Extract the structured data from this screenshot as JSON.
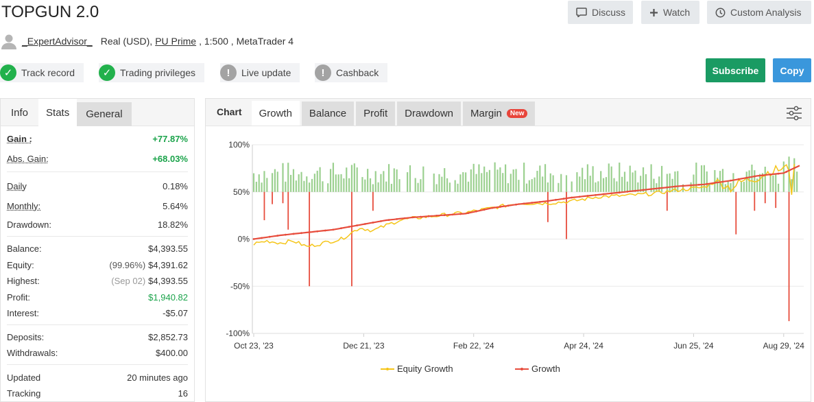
{
  "header": {
    "title": "TOPGUN 2.0",
    "buttons": {
      "discuss": "Discuss",
      "watch": "Watch",
      "custom_analysis": "Custom Analysis"
    }
  },
  "owner": {
    "name": "_ExpertAdvisor_",
    "account_type": "Real (USD),",
    "broker": "PU Prime",
    "details": ", 1:500 , MetaTrader 4"
  },
  "badges": [
    {
      "label": "Track record",
      "state": "verified"
    },
    {
      "label": "Trading privileges",
      "state": "verified"
    },
    {
      "label": "Live update",
      "state": "unavailable"
    },
    {
      "label": "Cashback",
      "state": "unavailable"
    }
  ],
  "actions": {
    "subscribe": "Subscribe",
    "copy": "Copy"
  },
  "left_tabs": [
    "Info",
    "Stats",
    "General"
  ],
  "stats": {
    "gain": {
      "label": "Gain :",
      "value": "+77.87%"
    },
    "abs_gain": {
      "label": "Abs. Gain:",
      "value": "+68.03%"
    },
    "daily": {
      "label": "Daily",
      "value": "0.18%"
    },
    "monthly": {
      "label": "Monthly:",
      "value": "5.64%"
    },
    "drawdown": {
      "label": "Drawdown:",
      "value": "18.82%"
    },
    "balance": {
      "label": "Balance:",
      "value": "$4,393.55"
    },
    "equity": {
      "label": "Equity:",
      "prefix": "(99.96%)",
      "value": "$4,391.62"
    },
    "highest": {
      "label": "Highest:",
      "prefix": "(Sep 02)",
      "value": "$4,393.55"
    },
    "profit": {
      "label": "Profit:",
      "value": "$1,940.82"
    },
    "interest": {
      "label": "Interest:",
      "value": "-$5.07"
    },
    "deposits": {
      "label": "Deposits:",
      "value": "$2,852.73"
    },
    "withdrawals": {
      "label": "Withdrawals:",
      "value": "$400.00"
    },
    "updated": {
      "label": "Updated",
      "value": "20 minutes ago"
    },
    "tracking": {
      "label": "Tracking",
      "value": "16"
    }
  },
  "chart_tabs": {
    "label": "Chart",
    "items": [
      "Growth",
      "Balance",
      "Profit",
      "Drawdown",
      "Margin"
    ],
    "new_badge": "New"
  },
  "colors": {
    "growth": "#e74c3c",
    "equity": "#f5c518",
    "bar": "#9bd08f",
    "green": "#1aa34a",
    "subscribe": "#1a9b63",
    "copy": "#3a97dc"
  },
  "chart_data": {
    "type": "line",
    "x_tick_labels": [
      "Oct 23, '23",
      "Dec 21, '23",
      "Feb 22, '24",
      "Apr 24, '24",
      "Jun 25, '24",
      "Aug 29, '24"
    ],
    "y_tick_labels": [
      "100%",
      "50%",
      "0%",
      "-50%",
      "-100%"
    ],
    "ylim": [
      -100,
      100
    ],
    "grid": true,
    "legend_position": "bottom",
    "series": [
      {
        "name": "Equity Growth",
        "color": "#f5c518",
        "start": 0,
        "end": 75,
        "approx_points": [
          [
            0,
            -5
          ],
          [
            5,
            -2
          ],
          [
            10,
            -4
          ],
          [
            15,
            -2
          ],
          [
            20,
            -8
          ],
          [
            25,
            -5
          ],
          [
            28,
            -3
          ],
          [
            33,
            0
          ],
          [
            40,
            12
          ],
          [
            45,
            9
          ],
          [
            55,
            20
          ],
          [
            60,
            22
          ],
          [
            70,
            25
          ],
          [
            80,
            28
          ],
          [
            90,
            33
          ],
          [
            100,
            38
          ],
          [
            110,
            38
          ],
          [
            120,
            40
          ],
          [
            130,
            45
          ],
          [
            140,
            46
          ],
          [
            150,
            48
          ],
          [
            160,
            52
          ],
          [
            170,
            55
          ],
          [
            175,
            62
          ],
          [
            180,
            54
          ],
          [
            185,
            62
          ],
          [
            190,
            65
          ],
          [
            195,
            72
          ],
          [
            200,
            75
          ]
        ]
      },
      {
        "name": "Growth",
        "color": "#e74c3c",
        "approx_points": [
          [
            0,
            0
          ],
          [
            10,
            4
          ],
          [
            20,
            7
          ],
          [
            30,
            10
          ],
          [
            40,
            15
          ],
          [
            50,
            20
          ],
          [
            60,
            23
          ],
          [
            70,
            25
          ],
          [
            80,
            27
          ],
          [
            90,
            33
          ],
          [
            100,
            37
          ],
          [
            110,
            40
          ],
          [
            120,
            44
          ],
          [
            130,
            47
          ],
          [
            140,
            50
          ],
          [
            150,
            53
          ],
          [
            160,
            56
          ],
          [
            170,
            58
          ],
          [
            180,
            62
          ],
          [
            190,
            67
          ],
          [
            200,
            70
          ],
          [
            206,
            77.87
          ]
        ]
      }
    ],
    "bars_note": "daily bars: green positive up to about +75%, red negative down to about -87%"
  }
}
